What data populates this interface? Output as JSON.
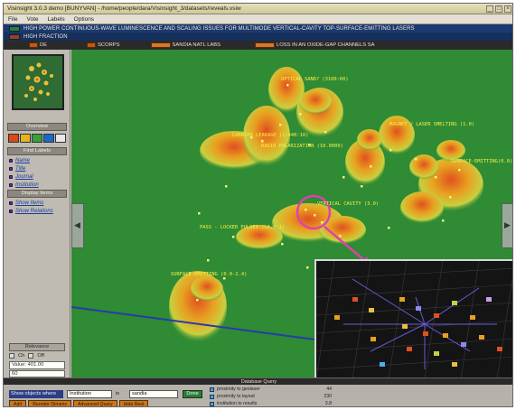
{
  "window": {
    "title": "Visinsight 3.0.3 demo [BUNYVAN] - /home/people/dara/Visinsight_3/datasets/reveals.vsiw",
    "buttons": [
      "_",
      "□",
      "×"
    ]
  },
  "menu": [
    "File",
    "Vote",
    "Labels",
    "Options"
  ],
  "query_bar": {
    "line1": "HIGH POWER CONTINUOUS-WAVE LUMINESCENCE AND SCALING ISSUES FOR MULTIMODE VERTICAL-CAVITY TOP-SURFACE-EMITTING LASERS",
    "line2": "HIGH FRACTION"
  },
  "tokens": [
    {
      "label": "DE"
    },
    {
      "label": "SCORPS"
    },
    {
      "label": "SANDIA NATL LABS"
    },
    {
      "label": "LOSS IN AN OXIDE-GAP CHANNELS SA"
    }
  ],
  "sidebar": {
    "overview_header": "Overview",
    "color_strip": [
      "#d84a1a",
      "#e8b21e",
      "#3aa03a",
      "#1a6ac8",
      "#e8e8e8"
    ],
    "find_header": "Find Labels",
    "find_items": [
      "Name",
      "Title",
      "Journal",
      "Institution"
    ],
    "display_header": "Display Items",
    "display_items": [
      "Show Items",
      "Show Relations"
    ],
    "bottom_button": "Relevance",
    "check_labels": [
      "Ch",
      "Off"
    ],
    "field_value": "Value: 401.00",
    "field2_value": "60"
  },
  "view": {
    "labels": [
      {
        "text": "OPTICAL SAND? (3100:60)"
      },
      {
        "text": "MAGNET / LASER SMELTING (1.0)"
      },
      {
        "text": "CARRIER LEAKAGE (1:440:10)"
      },
      {
        "text": "RADIO POLARIZATION (10.0000)"
      },
      {
        "text": "SURFACE-EMITTING(0.0)"
      },
      {
        "text": "VERTICAL CAVITY (3.0)"
      },
      {
        "text": "PASS - LOCKED PULSES (LA,0.1)"
      },
      {
        "text": "SURFACE-EMITTING (0.0-2.4)"
      }
    ],
    "left_arrow": "◀",
    "right_arrow": "▶"
  },
  "bottom": {
    "bar_label": "Database Query",
    "query": {
      "select_label": "Show objects where",
      "attribute": "Institution",
      "operator": "is",
      "value": "sandia",
      "go": "Done"
    },
    "tabs": [
      "Add",
      "Reorder Dimens",
      "Advanced Query",
      "Hide Rest"
    ],
    "results": [
      {
        "name": "proximity to geolaser",
        "count": "44"
      },
      {
        "name": "proximity to layout",
        "count": "230"
      },
      {
        "name": "institution to results",
        "count": "3.8"
      }
    ]
  },
  "colors": {
    "terrain_ground": "#2f8b34",
    "peak_low": "#c8d040",
    "peak_mid": "#e8a020",
    "peak_high": "#e05020",
    "highlight": "#e040b0",
    "link": "#2a3aa8",
    "label": "#f6f04a"
  }
}
